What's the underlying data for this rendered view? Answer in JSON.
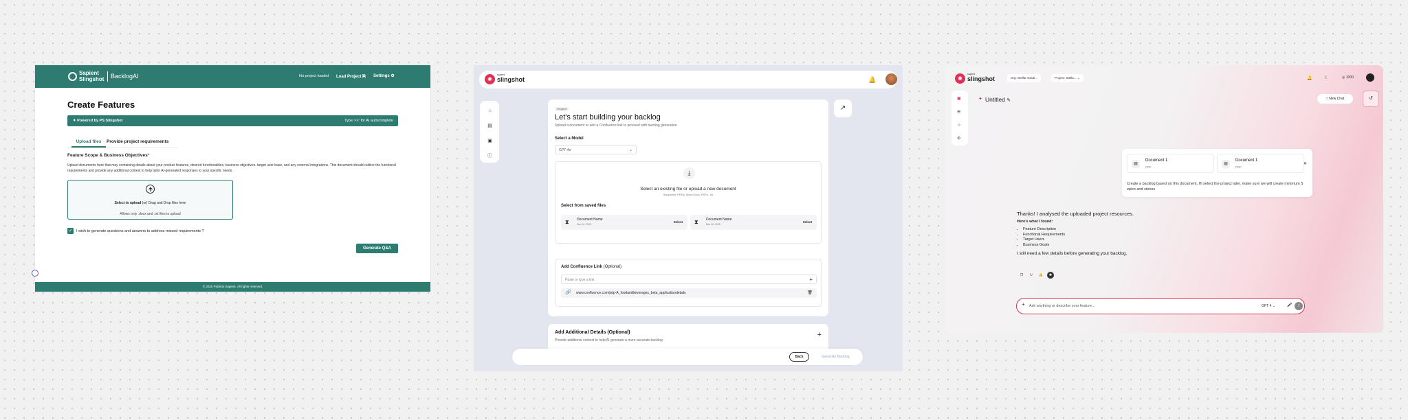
{
  "panel1": {
    "logo_text": "Sapient Slingshot",
    "app_name": "BacklogAI",
    "status": "No project loaded",
    "load_project": "Load Project",
    "settings": "Settings",
    "page_title": "Create Features",
    "banner_left": "Powered by PS Slingshot",
    "banner_right": "Type '<<' for AI autocomplete",
    "tabs": [
      "Upload files",
      "Provide project requirements"
    ],
    "section_title": "Feature Scope & Business Objectives",
    "required_mark": "*",
    "section_desc": "Upload documents here that may containing details about your product features, desired functionalities, business objectives, target user base, and any external integrations. This document should outline the functional requirements and provide any additional context to help tailor AI-generated responses to your specific needs.",
    "upload_line1_bold": "Select to upload",
    "upload_line1_rest": " (or) Drag and Drop files here",
    "upload_line2": "Allows only .docx and .txt files to upload",
    "checkbox_label": "I wish to generate questions and answers to address missed requirements ?",
    "generate_button": "Generate Q&A",
    "footer": "© 2025 Publicis Sapient. All rights reserved."
  },
  "panel2": {
    "logo_sub": "sapient",
    "logo_main": "slingshot",
    "breadcrumb": "Slingshot",
    "title": "Let's start building your backlog",
    "subtitle": "Upload a document or add a Confluence link to proceed with backlog generation",
    "model_label": "Select a Model",
    "model_value": "GPT-4o",
    "drop_title": "Select an existing file or upload a new document",
    "drop_sub": "Supported: PRDs, Word Docs, PDFs, .txt",
    "saved_label": "Select from saved files",
    "files": [
      {
        "name": "Document Name",
        "date": "Dec 24, 2025",
        "action": "Select"
      },
      {
        "name": "Document Name",
        "date": "Dec 24, 2025",
        "action": "Select"
      }
    ],
    "confluence_label": "Add Confluence Link",
    "confluence_optional": " (Optional)",
    "confluence_placeholder": "Paste or type a link",
    "confluence_link": "www.confluence.com/pdp-A_foodandbeverages_beta_applicationdetails",
    "additional_title": "Add Additional Details (Optional)",
    "additional_sub": "Provide additional context to help AI generate a more accurate backlog",
    "back": "Back",
    "generate": "Generate Backlog"
  },
  "panel3": {
    "logo_sub": "sapient",
    "logo_main": "slingshot",
    "org": "Org: Stellar Soluti...",
    "project": "Project: Stella...",
    "credits": "1000",
    "title": "Untitled",
    "new_chat": "New Chat",
    "docs": [
      {
        "name": "Document 1",
        "type": "PDF"
      },
      {
        "name": "Document 1",
        "type": "PDF"
      }
    ],
    "user_message": "Create a backlog based on this document, I'll select the project later. make sure we will create minimum 5 epics and stories",
    "reply_intro": "Thanks! I analysed the uploaded project resources.",
    "reply_found": "Here's what I found:",
    "reply_items": [
      "Feature Description",
      "Functional Requirements",
      "Target Users",
      "Business Goals"
    ],
    "reply_outro": "I still need a few details before generating your backlog.",
    "composer_placeholder": "Ask anything or describe your feature...",
    "model": "GPT 4"
  }
}
